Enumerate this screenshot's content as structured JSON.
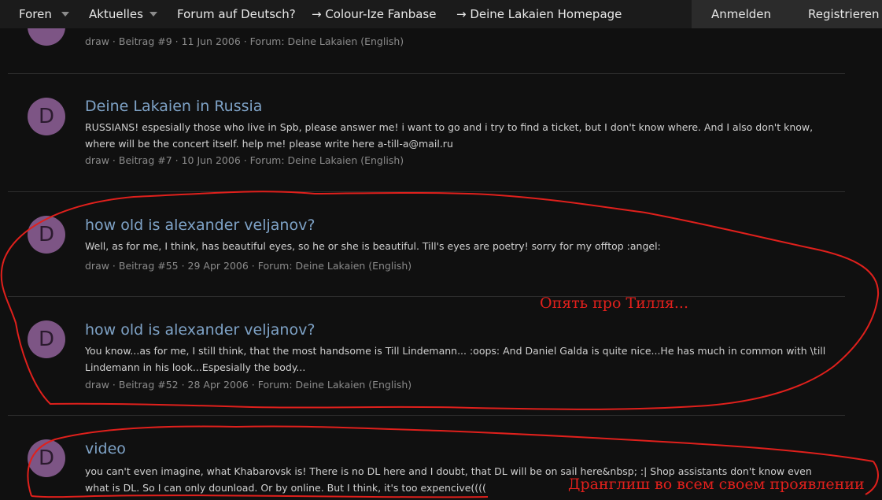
{
  "nav": {
    "items": [
      {
        "label": "Foren"
      },
      {
        "label": "Aktuelles"
      },
      {
        "label": "Forum auf Deutsch?"
      },
      {
        "label": "→ Colour-Ize Fanbase"
      },
      {
        "label": "→ Deine Lakaien Homepage"
      }
    ],
    "login": "Anmelden",
    "register": "Registrieren"
  },
  "results": [
    {
      "meta": "draw · Beitrag #9 · 11 Jun 2006 · Forum: Deine Lakaien (English)"
    },
    {
      "avatar": "D",
      "title": "Deine Lakaien in Russia",
      "snippet": "RUSSIANS! espesially those who live in Spb, please answer me! i want to go and i try to find a ticket, but I don't know where. And I also don't know, where will be the concert itself. help me! please write here a-till-a@mail.ru",
      "meta": "draw · Beitrag #7 · 10 Jun 2006 · Forum: Deine Lakaien (English)"
    },
    {
      "avatar": "D",
      "title": "how old is alexander veljanov?",
      "snippet": "Well, as for me, I think, has beautiful eyes, so he or she is beautiful. Till's eyes are poetry! sorry for my offtop :angel:",
      "meta": "draw · Beitrag #55 · 29 Apr 2006 · Forum: Deine Lakaien (English)"
    },
    {
      "avatar": "D",
      "title": "how old is alexander veljanov?",
      "snippet": "You know...as for me, I still think, that the most handsome is Till Lindemann... :oops: And Daniel Galda is quite nice...He has much in common with \\till Lindemann in his look...Espesially the body...",
      "meta": "draw · Beitrag #52 · 28 Apr 2006 · Forum: Deine Lakaien (English)"
    },
    {
      "avatar": "D",
      "title": "video",
      "snippet": "you can't even imagine, what Khabarovsk is! There is no DL here and I doubt, that DL will be on sail here&nbsp; :| Shop assistants don't know even what is DL. So I can only dounload. Or by online. But I think, it's too expencive(((("
    }
  ],
  "annotations": {
    "till_note": "Опять про Тилля...",
    "drangl_note": "Дранглиш  во всем своем проявлении",
    "color": "#e0201c"
  },
  "colors": {
    "background": "#101010",
    "nav": "#1b1b1b",
    "link": "#7ea2c6",
    "avatar": "#7d5585"
  }
}
